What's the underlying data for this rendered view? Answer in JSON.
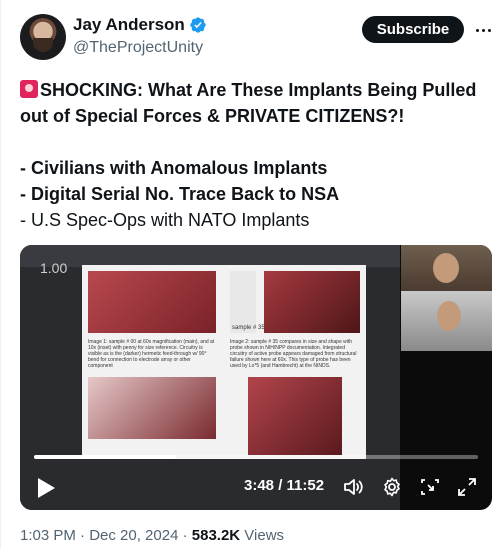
{
  "author": {
    "name": "Jay Anderson",
    "handle": "@TheProjectUnity"
  },
  "actions": {
    "subscribe_label": "Subscribe"
  },
  "tweet": {
    "headline": "SHOCKING: What Are These Implants Being Pulled out of Special Forces & PRIVATE CITIZENS?!",
    "bullets": [
      "- Civilians with Anomalous Implants",
      "- Digital Serial No. Trace Back to NSA",
      "- U.S Spec-Ops with NATO Implants"
    ]
  },
  "video": {
    "zoom_label": "1.00",
    "time_display": "3:48 / 11:52",
    "progress_fraction": 0.32,
    "screen_captions": [
      "Image 1: sample # 00 at 60x magnification (main), and at 10x (inset) with penny for size reference. Circuitry is visible as is the (darker) hermetic feed-through w/ 90° bend for connection to electrode array or other component",
      "Image 2: sample # 35 compares in size and shape with probe shown in NIH/NPP documentation. Integrated circuitry of active probe appears damaged from structural failure shown here at 60x. This type of probe has been used by Lo*5 (and Hambrecht) at the NINDS."
    ],
    "sample_label": "sample # 35"
  },
  "meta": {
    "timestamp": "1:03 PM · Dec 20, 2024 · ",
    "views_count": "583.2K",
    "views_label": " Views"
  },
  "colors": {
    "verified": "#1d9bf0",
    "text_primary": "#0f1419",
    "text_secondary": "#536471"
  }
}
